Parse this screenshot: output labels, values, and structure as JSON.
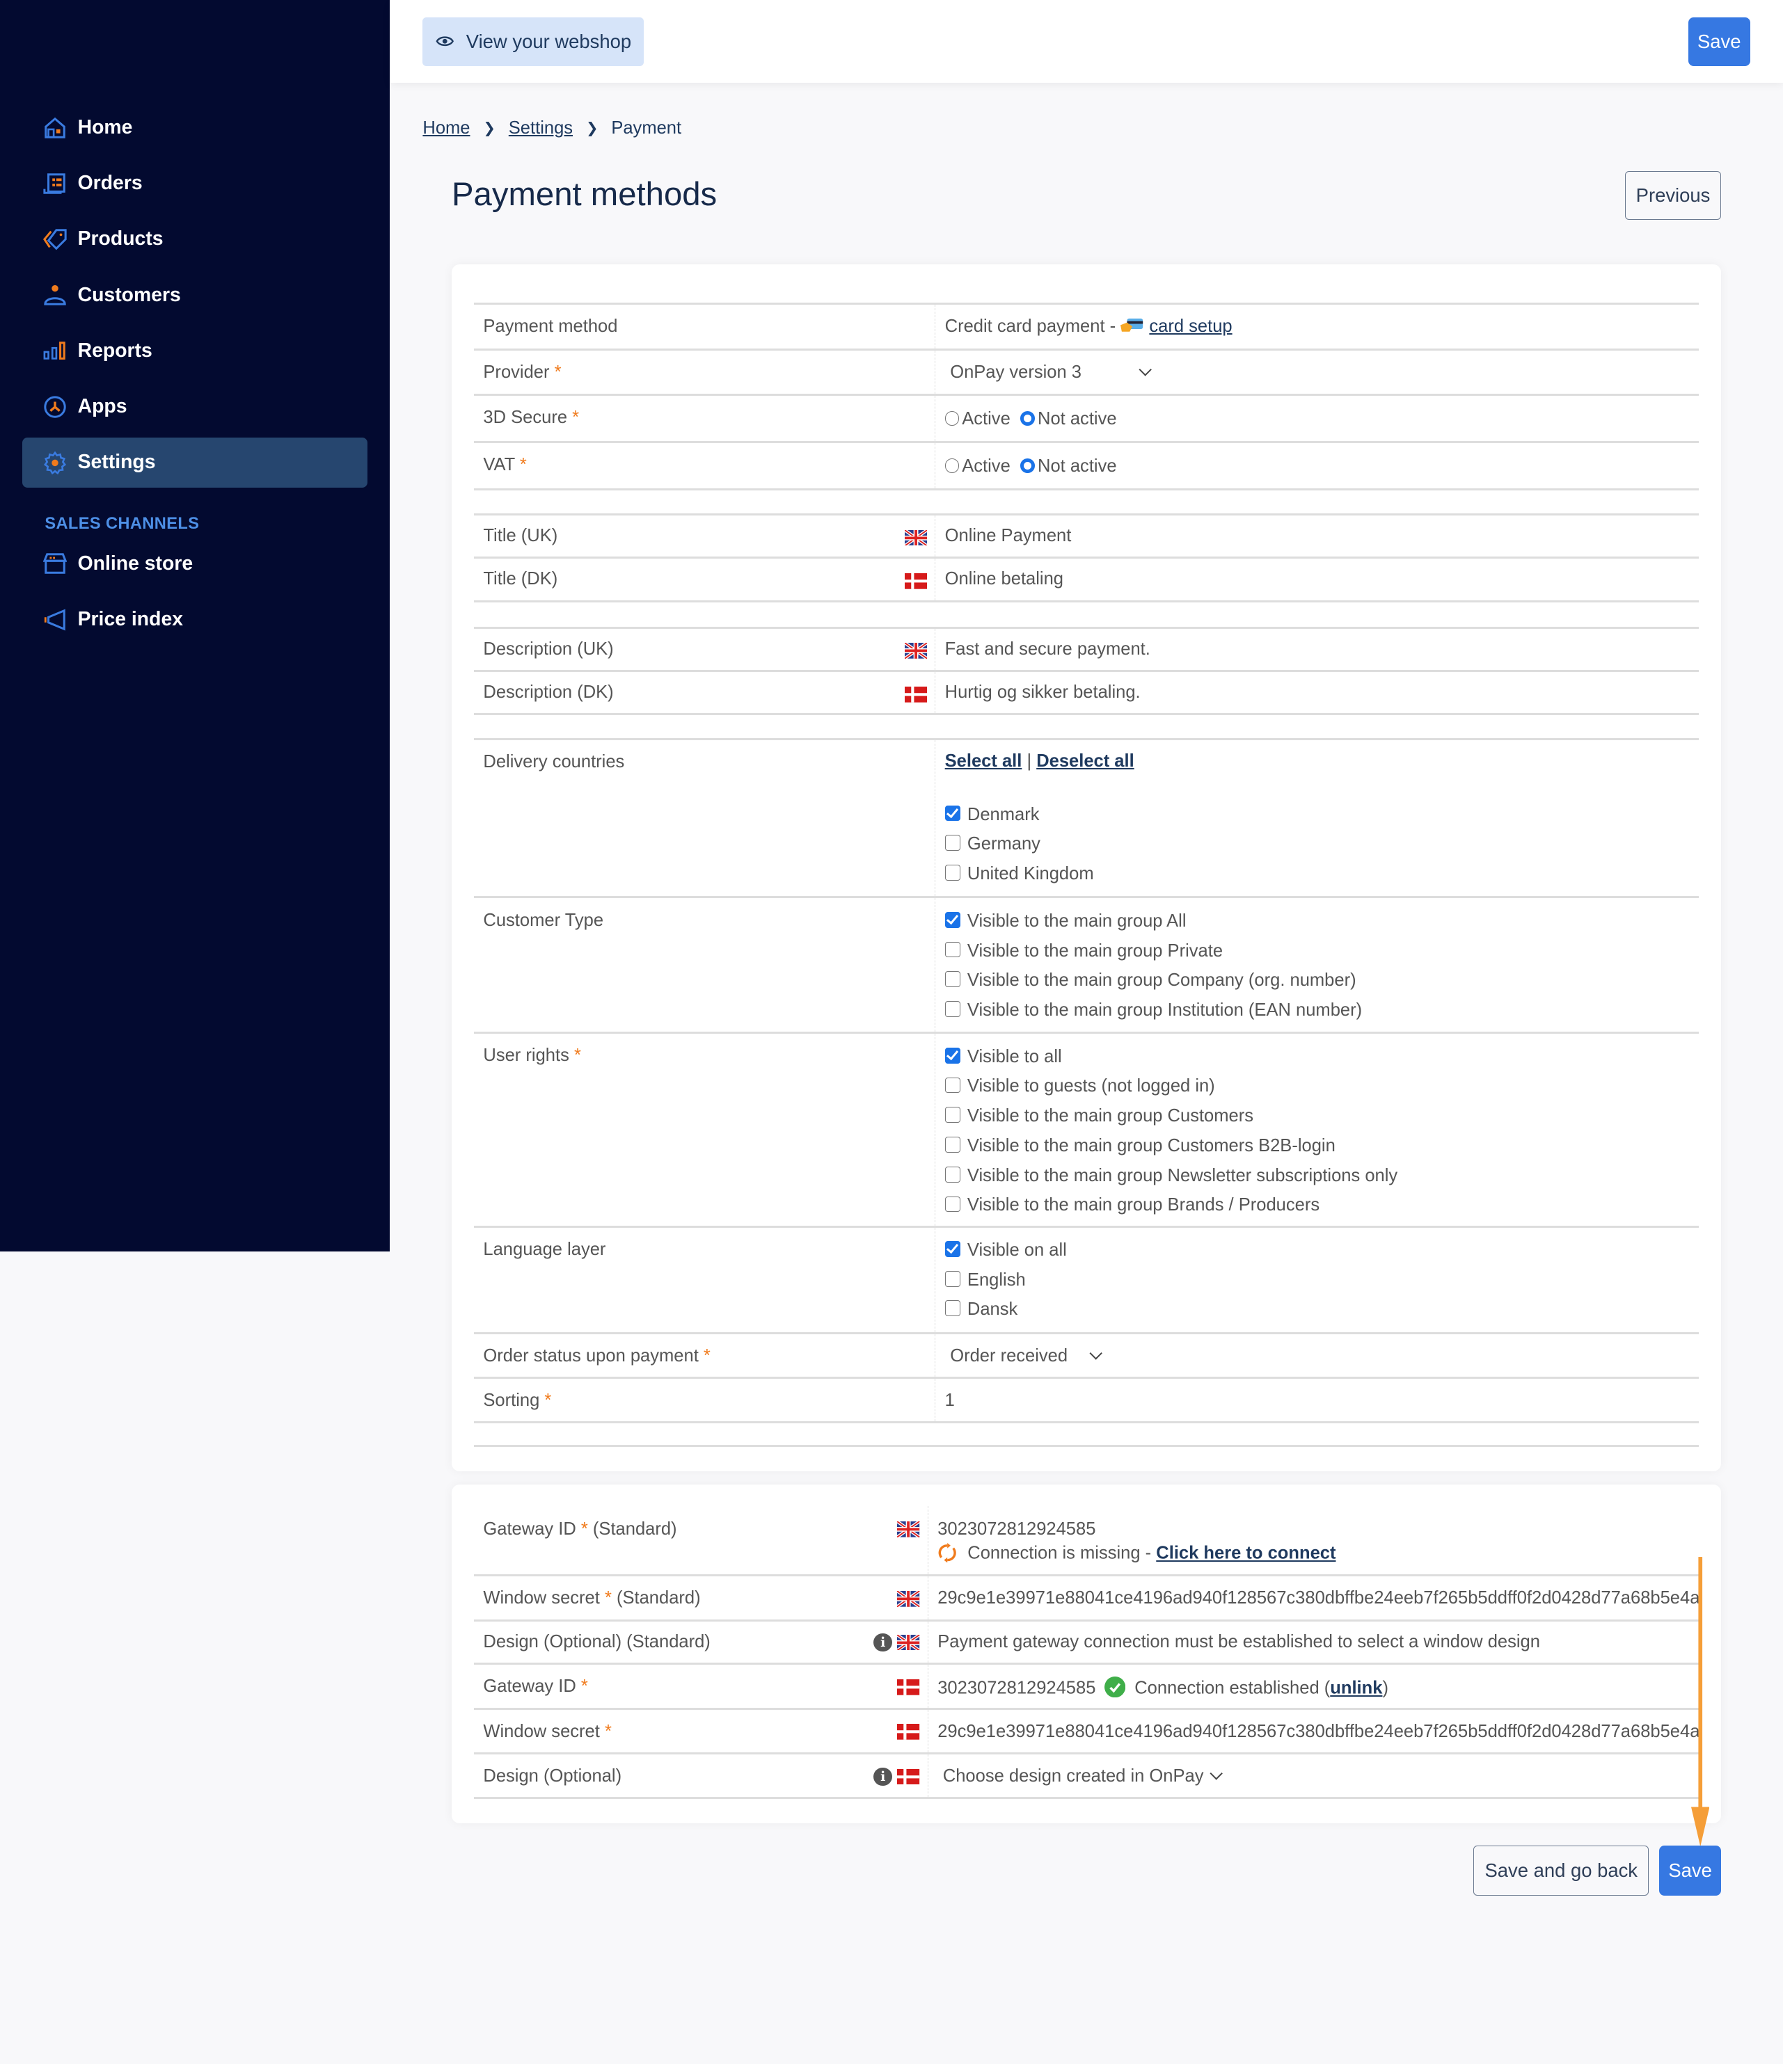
{
  "sidebar": {
    "items": [
      {
        "label": "Home",
        "icon": "home-icon"
      },
      {
        "label": "Orders",
        "icon": "orders-icon"
      },
      {
        "label": "Products",
        "icon": "tag-icon"
      },
      {
        "label": "Customers",
        "icon": "user-icon"
      },
      {
        "label": "Reports",
        "icon": "bar-chart-icon"
      },
      {
        "label": "Apps",
        "icon": "apps-icon"
      },
      {
        "label": "Settings",
        "icon": "gear-icon",
        "active": true
      }
    ],
    "section_label": "SALES CHANNELS",
    "channels": [
      {
        "label": "Online store",
        "icon": "store-icon"
      },
      {
        "label": "Price index",
        "icon": "megaphone-icon"
      }
    ]
  },
  "topbar": {
    "view_webshop_label": "View your webshop",
    "save_label": "Save"
  },
  "breadcrumb": {
    "items": [
      "Home",
      "Settings"
    ],
    "current": "Payment"
  },
  "page": {
    "title": "Payment methods",
    "previous_label": "Previous"
  },
  "form": {
    "payment_method": {
      "label": "Payment method",
      "value": "Credit card payment - ",
      "link": " card setup"
    },
    "provider": {
      "label": "Provider",
      "value": "OnPay version 3"
    },
    "secure3d": {
      "label": "3D Secure",
      "options": [
        "Active",
        "Not active"
      ],
      "selected": "Not active"
    },
    "vat": {
      "label": "VAT",
      "options": [
        "Active",
        "Not active"
      ],
      "selected": "Not active"
    },
    "title_uk": {
      "label": "Title (UK)",
      "value": "Online Payment"
    },
    "title_dk": {
      "label": "Title (DK)",
      "value": "Online betaling"
    },
    "desc_uk": {
      "label": "Description (UK)",
      "value": "Fast and secure payment."
    },
    "desc_dk": {
      "label": "Description (DK)",
      "value": "Hurtig og sikker betaling."
    },
    "delivery": {
      "label": "Delivery countries",
      "select_all": "Select all",
      "separator": "|",
      "deselect_all": "Deselect all",
      "options": [
        {
          "label": "Denmark",
          "checked": true
        },
        {
          "label": "Germany",
          "checked": false
        },
        {
          "label": "United Kingdom",
          "checked": false
        }
      ]
    },
    "customer_type": {
      "label": "Customer Type",
      "options": [
        {
          "label": "Visible to the main group All",
          "checked": true
        },
        {
          "label": "Visible to the main group Private",
          "checked": false
        },
        {
          "label": "Visible to the main group Company (org. number)",
          "checked": false
        },
        {
          "label": "Visible to the main group Institution (EAN number)",
          "checked": false
        }
      ]
    },
    "user_rights": {
      "label": "User rights",
      "options": [
        {
          "label": "Visible to all",
          "checked": true
        },
        {
          "label": "Visible to guests (not logged in)",
          "checked": false
        },
        {
          "label": "Visible to the main group Customers",
          "checked": false
        },
        {
          "label": "Visible to the main group Customers B2B-login",
          "checked": false
        },
        {
          "label": "Visible to the main group Newsletter subscriptions only",
          "checked": false
        },
        {
          "label": "Visible to the main group Brands / Producers",
          "checked": false
        }
      ]
    },
    "language": {
      "label": "Language layer",
      "options": [
        {
          "label": "Visible on all",
          "checked": true
        },
        {
          "label": "English",
          "checked": false
        },
        {
          "label": "Dansk",
          "checked": false
        }
      ]
    },
    "order_status": {
      "label": "Order status upon payment",
      "value": "Order received"
    },
    "sorting": {
      "label": "Sorting",
      "value": "1"
    }
  },
  "gateway": {
    "gw_std": {
      "label": "Gateway ID",
      "suffix": " (Standard)",
      "value": "3023072812924585",
      "status": "Connection is missing - ",
      "link": "Click here to connect"
    },
    "secret_std": {
      "label": "Window secret",
      "suffix": " (Standard)",
      "value": "29c9e1e39971e88041ce4196ad940f128567c380dbffbe24eeb7f265b5ddff0f2d0428d77a68b5e4a"
    },
    "design_std": {
      "label": "Design (Optional) (Standard)",
      "value": "Payment gateway connection must be established to select a window design"
    },
    "gw_dk": {
      "label": "Gateway ID",
      "value": "3023072812924585",
      "status": "Connection established (",
      "link": "unlink",
      "status_end": ")"
    },
    "secret_dk": {
      "label": "Window secret",
      "value": "29c9e1e39971e88041ce4196ad940f128567c380dbffbe24eeb7f265b5ddff0f2d0428d77a68b5e4a"
    },
    "design_dk": {
      "label": "Design (Optional)",
      "value": "Choose design created in OnPay"
    }
  },
  "footer": {
    "save_back_label": "Save and go back",
    "save_label": "Save"
  },
  "required_mark": "*",
  "info_glyph": "i",
  "colors": {
    "sidebar_bg": "#030a30",
    "accent": "#3678e2",
    "required": "#f07b1d",
    "annotation_arrow": "#f59e38"
  }
}
